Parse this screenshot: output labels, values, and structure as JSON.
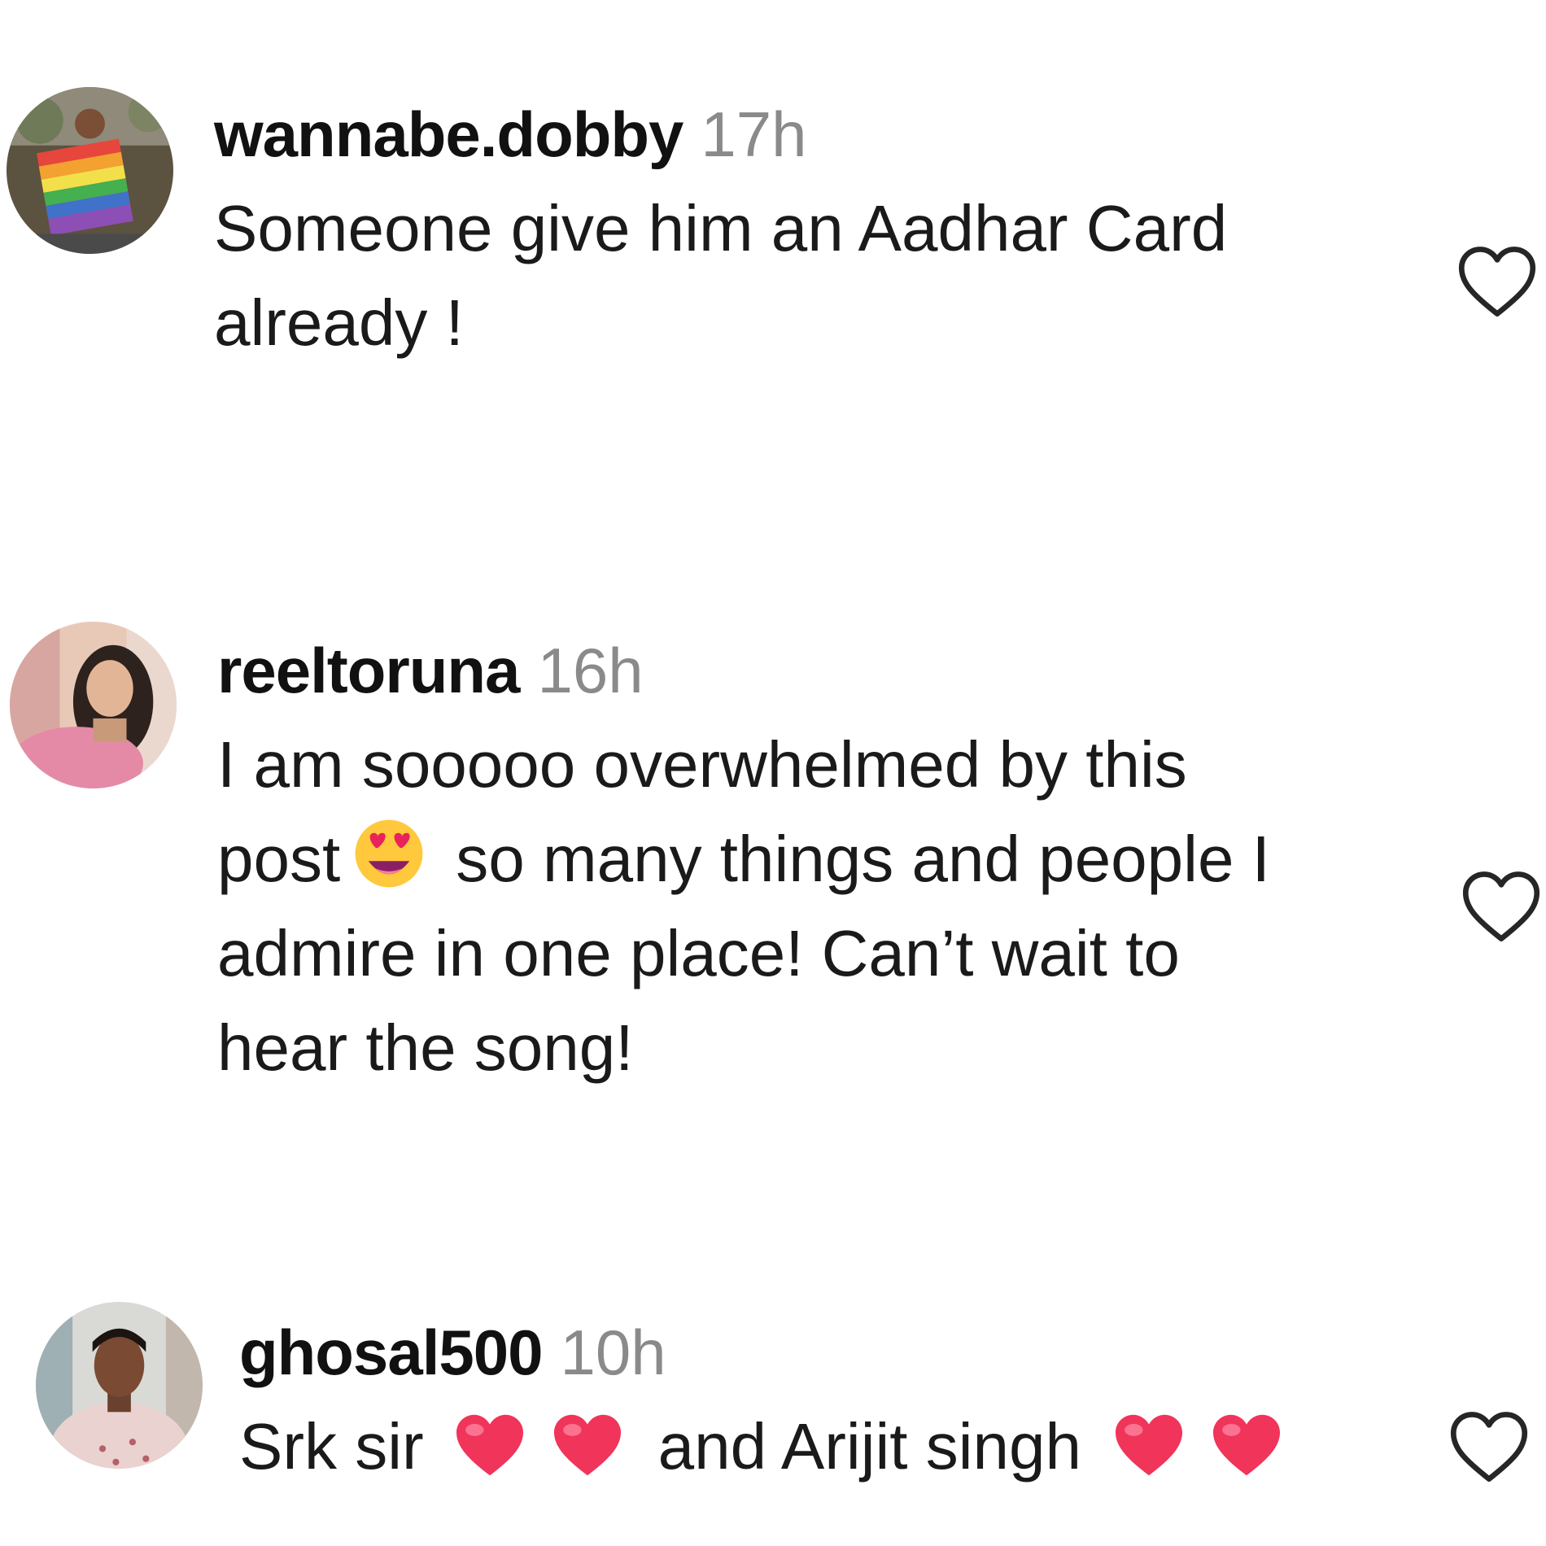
{
  "comments": [
    {
      "username": "wannabe.dobby",
      "time": "17h",
      "lines": [
        "Someone give him an Aadhar Card",
        "already !"
      ]
    },
    {
      "username": "reeltoruna",
      "time": "16h",
      "line1": "I am sooooo overwhelmed by this",
      "line2a": "post",
      "line2b": "so many things and people I",
      "line3": "admire in one place! Can’t wait to",
      "line4": "hear the song!"
    },
    {
      "username": "ghosal500",
      "time": "10h",
      "part1": "Srk sir",
      "part2": "and Arijit singh"
    }
  ],
  "icons": {
    "like": "heart-outline-icon",
    "emoji_star_eyes": "star-struck-emoji",
    "emoji_heart": "red-heart-emoji"
  },
  "colors": {
    "timestamp": "#8a8a8a",
    "heart_outline": "#262626",
    "heart_emoji": "#f0345a"
  }
}
